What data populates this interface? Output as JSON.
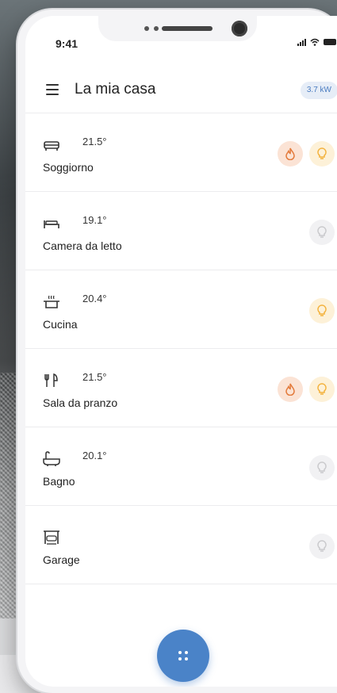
{
  "status": {
    "time": "9:41"
  },
  "header": {
    "title": "La mia casa",
    "power": "3.7 kW"
  },
  "colors": {
    "accent": "#4a83c8",
    "heat": "#e37a3b",
    "light_on": "#f3b13b",
    "light_off": "#c9c9cc"
  },
  "rooms": [
    {
      "temp": "21.5°",
      "name": "Soggiorno",
      "icon": "sofa-icon",
      "heat": true,
      "light": true
    },
    {
      "temp": "19.1°",
      "name": "Camera da letto",
      "icon": "bed-icon",
      "heat": false,
      "light": false
    },
    {
      "temp": "20.4°",
      "name": "Cucina",
      "icon": "cooking-pot-icon",
      "heat": false,
      "light": true
    },
    {
      "temp": "21.5°",
      "name": "Sala da pranzo",
      "icon": "fork-knife-icon",
      "heat": true,
      "light": true
    },
    {
      "temp": "20.1°",
      "name": "Bagno",
      "icon": "bathtub-icon",
      "heat": false,
      "light": false
    },
    {
      "temp": "",
      "name": "Garage",
      "icon": "garage-icon",
      "heat": false,
      "light": false
    }
  ],
  "fab": {
    "icon": "grid-dots-icon"
  }
}
